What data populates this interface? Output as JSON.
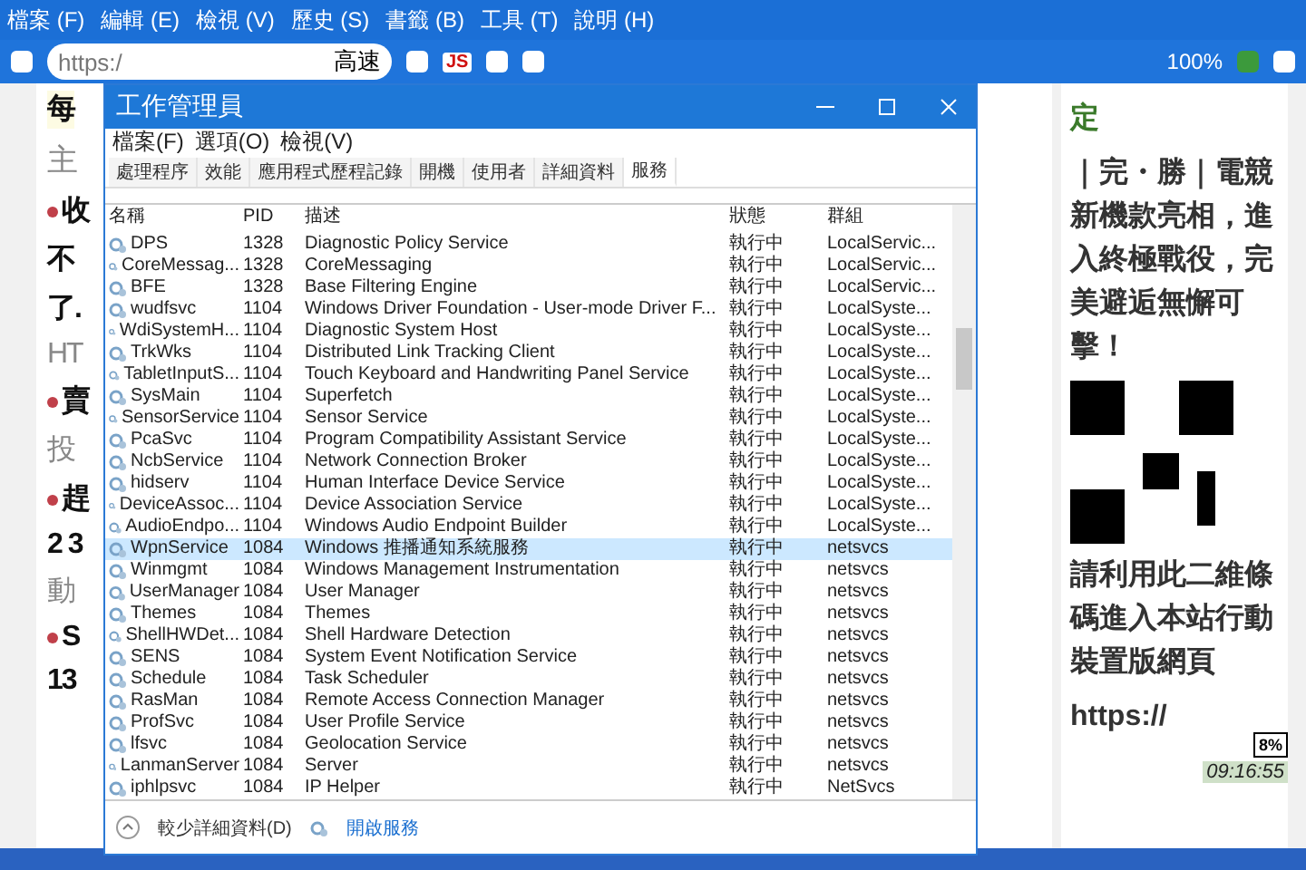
{
  "browser": {
    "menu": [
      "檔案 (F)",
      "編輯 (E)",
      "檢視 (V)",
      "歷史 (S)",
      "書籤 (B)",
      "工具 (T)",
      "說明 (H)"
    ],
    "url": "https:/",
    "speed_label": "高速",
    "js_label": "JS",
    "zoom": "100%"
  },
  "page": {
    "left_fragments": [
      {
        "text": "每",
        "kind": "banner"
      },
      {
        "text": "主",
        "kind": "heading"
      },
      {
        "text": "收",
        "kind": "bullet"
      },
      {
        "text": "不",
        "kind": "bold"
      },
      {
        "text": "了.",
        "kind": "bold"
      },
      {
        "text": "HT",
        "kind": "grey"
      },
      {
        "text": "賣",
        "kind": "bullet"
      },
      {
        "text": "投",
        "kind": "grey"
      },
      {
        "text": "趕",
        "kind": "bullet"
      },
      {
        "text": "2 3",
        "kind": "bold"
      },
      {
        "text": "動",
        "kind": "grey"
      },
      {
        "text": "S",
        "kind": "bullet"
      },
      {
        "text": "13",
        "kind": "bold"
      }
    ],
    "sidebar": {
      "headline_end": "定",
      "promo": "｜完・勝｜電競新機款亮相，進入終極戰役，完美避逅無懈可擊！",
      "qr_caption": "請利用此二維條碼進入本站行動裝置版網頁",
      "link": "https://"
    }
  },
  "task_manager": {
    "title": "工作管理員",
    "menu": [
      "檔案(F)",
      "選項(O)",
      "檢視(V)"
    ],
    "tabs": [
      {
        "label": "處理程序",
        "selected": false
      },
      {
        "label": "效能",
        "selected": false
      },
      {
        "label": "應用程式歷程記錄",
        "selected": false
      },
      {
        "label": "開機",
        "selected": false
      },
      {
        "label": "使用者",
        "selected": false
      },
      {
        "label": "詳細資料",
        "selected": false
      },
      {
        "label": "服務",
        "selected": true
      }
    ],
    "columns": [
      "名稱",
      "PID",
      "描述",
      "狀態",
      "群組"
    ],
    "rows": [
      {
        "name": "DPS",
        "pid": "1328",
        "description": "Diagnostic Policy Service",
        "status": "執行中",
        "group": "LocalServic...",
        "selected": false
      },
      {
        "name": "CoreMessag...",
        "pid": "1328",
        "description": "CoreMessaging",
        "status": "執行中",
        "group": "LocalServic...",
        "selected": false
      },
      {
        "name": "BFE",
        "pid": "1328",
        "description": "Base Filtering Engine",
        "status": "執行中",
        "group": "LocalServic...",
        "selected": false
      },
      {
        "name": "wudfsvc",
        "pid": "1104",
        "description": "Windows Driver Foundation - User-mode Driver F...",
        "status": "執行中",
        "group": "LocalSyste...",
        "selected": false
      },
      {
        "name": "WdiSystemH...",
        "pid": "1104",
        "description": "Diagnostic System Host",
        "status": "執行中",
        "group": "LocalSyste...",
        "selected": false
      },
      {
        "name": "TrkWks",
        "pid": "1104",
        "description": "Distributed Link Tracking Client",
        "status": "執行中",
        "group": "LocalSyste...",
        "selected": false
      },
      {
        "name": "TabletInputS...",
        "pid": "1104",
        "description": "Touch Keyboard and Handwriting Panel Service",
        "status": "執行中",
        "group": "LocalSyste...",
        "selected": false
      },
      {
        "name": "SysMain",
        "pid": "1104",
        "description": "Superfetch",
        "status": "執行中",
        "group": "LocalSyste...",
        "selected": false
      },
      {
        "name": "SensorService",
        "pid": "1104",
        "description": "Sensor Service",
        "status": "執行中",
        "group": "LocalSyste...",
        "selected": false
      },
      {
        "name": "PcaSvc",
        "pid": "1104",
        "description": "Program Compatibility Assistant Service",
        "status": "執行中",
        "group": "LocalSyste...",
        "selected": false
      },
      {
        "name": "NcbService",
        "pid": "1104",
        "description": "Network Connection Broker",
        "status": "執行中",
        "group": "LocalSyste...",
        "selected": false
      },
      {
        "name": "hidserv",
        "pid": "1104",
        "description": "Human Interface Device Service",
        "status": "執行中",
        "group": "LocalSyste...",
        "selected": false
      },
      {
        "name": "DeviceAssoc...",
        "pid": "1104",
        "description": "Device Association Service",
        "status": "執行中",
        "group": "LocalSyste...",
        "selected": false
      },
      {
        "name": "AudioEndpo...",
        "pid": "1104",
        "description": "Windows Audio Endpoint Builder",
        "status": "執行中",
        "group": "LocalSyste...",
        "selected": false
      },
      {
        "name": "WpnService",
        "pid": "1084",
        "description": "Windows 推播通知系統服務",
        "status": "執行中",
        "group": "netsvcs",
        "selected": true
      },
      {
        "name": "Winmgmt",
        "pid": "1084",
        "description": "Windows Management Instrumentation",
        "status": "執行中",
        "group": "netsvcs",
        "selected": false
      },
      {
        "name": "UserManager",
        "pid": "1084",
        "description": "User Manager",
        "status": "執行中",
        "group": "netsvcs",
        "selected": false
      },
      {
        "name": "Themes",
        "pid": "1084",
        "description": "Themes",
        "status": "執行中",
        "group": "netsvcs",
        "selected": false
      },
      {
        "name": "ShellHWDet...",
        "pid": "1084",
        "description": "Shell Hardware Detection",
        "status": "執行中",
        "group": "netsvcs",
        "selected": false
      },
      {
        "name": "SENS",
        "pid": "1084",
        "description": "System Event Notification Service",
        "status": "執行中",
        "group": "netsvcs",
        "selected": false
      },
      {
        "name": "Schedule",
        "pid": "1084",
        "description": "Task Scheduler",
        "status": "執行中",
        "group": "netsvcs",
        "selected": false
      },
      {
        "name": "RasMan",
        "pid": "1084",
        "description": "Remote Access Connection Manager",
        "status": "執行中",
        "group": "netsvcs",
        "selected": false
      },
      {
        "name": "ProfSvc",
        "pid": "1084",
        "description": "User Profile Service",
        "status": "執行中",
        "group": "netsvcs",
        "selected": false
      },
      {
        "name": "lfsvc",
        "pid": "1084",
        "description": "Geolocation Service",
        "status": "執行中",
        "group": "netsvcs",
        "selected": false
      },
      {
        "name": "LanmanServer",
        "pid": "1084",
        "description": "Server",
        "status": "執行中",
        "group": "netsvcs",
        "selected": false
      },
      {
        "name": "iphlpsvc",
        "pid": "1084",
        "description": "IP Helper",
        "status": "執行中",
        "group": "NetSvcs",
        "selected": false
      }
    ],
    "fewer_details": "較少詳細資料(D)",
    "open_services": "開啟服務"
  },
  "meter_widget": {
    "percent": "8%",
    "clock": "09:16:55"
  }
}
